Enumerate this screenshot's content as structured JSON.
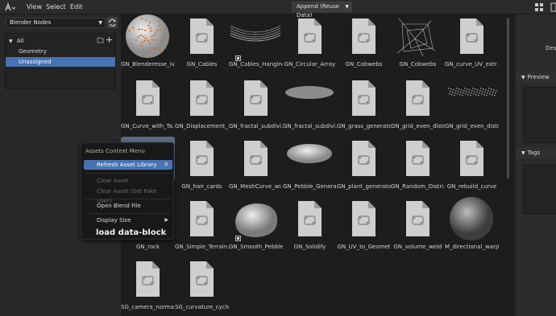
{
  "topbar": {
    "menu": [
      "View",
      "Select",
      "Edit"
    ],
    "import_method": "Append (Reuse Data)"
  },
  "sidebar": {
    "library": "Blender Nodes",
    "catalogs": [
      {
        "label": "All",
        "expanded": true
      },
      {
        "label": "Geometry"
      },
      {
        "label": "Unassigned",
        "selected": true
      }
    ]
  },
  "assets": [
    {
      "label": "GN_Blenderesse_iv...",
      "preview": "sphere-orange"
    },
    {
      "label": "GN_Cables",
      "preview": "file"
    },
    {
      "label": "GN_Cables_Hanging",
      "preview": "cables"
    },
    {
      "label": "GN_Circular_Array",
      "preview": "file"
    },
    {
      "label": "GN_Cobwebs",
      "preview": "file"
    },
    {
      "label": "GN_Cobwebs",
      "preview": "web"
    },
    {
      "label": "GN_curve_UV_extr...",
      "preview": "file"
    },
    {
      "label": "GN_Curve_with_Ta...",
      "preview": "file"
    },
    {
      "label": "GN_Displacement_...",
      "preview": "file"
    },
    {
      "label": "GN_fractal_subdivi...",
      "preview": "file"
    },
    {
      "label": "GN_fractal_subdivi...",
      "preview": "disc"
    },
    {
      "label": "GN_grass_generator",
      "preview": "file"
    },
    {
      "label": "GN_grid_even_distr",
      "preview": "file"
    },
    {
      "label": "GN_grid_even_distr",
      "preview": "dots"
    },
    {
      "label": "",
      "preview": "selected"
    },
    {
      "label": "GN_hair_cards",
      "preview": "file"
    },
    {
      "label": "GN_MeshCurve_wi...",
      "preview": "file"
    },
    {
      "label": "GN_Pebble_Genera...",
      "preview": "pebble"
    },
    {
      "label": "GN_plant_generato...",
      "preview": "file"
    },
    {
      "label": "GN_Random_Distri...",
      "preview": "file"
    },
    {
      "label": "GN_rebuild_curve",
      "preview": "file"
    },
    {
      "label": "GN_rock",
      "preview": "file"
    },
    {
      "label": "GN_Simple_Terrain...",
      "preview": "file"
    },
    {
      "label": "GN_Smooth_Pebble",
      "preview": "smooth"
    },
    {
      "label": "GN_Solidify",
      "preview": "file"
    },
    {
      "label": "GN_UV_to_Geomet",
      "preview": "file"
    },
    {
      "label": "GN_volume_weld",
      "preview": "file"
    },
    {
      "label": "M_directional_warp",
      "preview": "sphere-gray"
    },
    {
      "label": "SG_camera_norma...",
      "preview": "file"
    },
    {
      "label": "SG_curvature_cycle",
      "preview": "file"
    }
  ],
  "right_panel": {
    "description_label": "Desc",
    "preview_label": "Preview",
    "tags_label": "Tags"
  },
  "context_menu": {
    "title": "Assets Context Menu",
    "items": [
      {
        "label": "Refresh Asset Library",
        "shortcut": "R",
        "active": true
      },
      {
        "label": "Clear Asset",
        "disabled": true
      },
      {
        "label": "Clear Asset (Set Fake User)",
        "disabled": true
      },
      {
        "label": "Open Blend File"
      },
      {
        "label": "Display Size",
        "submenu": true
      }
    ],
    "tooltip": "load data-block"
  },
  "colors": {
    "accent": "#4772b3",
    "background": "#1d1d1d"
  }
}
